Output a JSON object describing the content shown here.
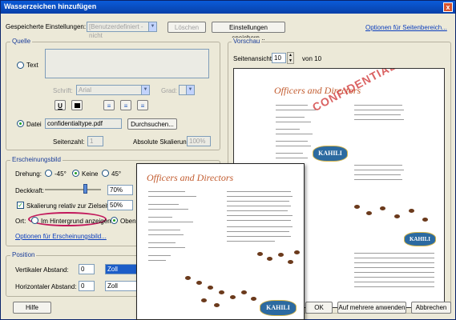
{
  "window": {
    "title": "Wasserzeichen hinzufügen",
    "close": "x"
  },
  "top": {
    "saved_label": "Gespeicherte Einstellungen:",
    "saved_value": "[Benutzerdefiniert - nicht",
    "delete": "Löschen",
    "save": "Einstellungen speichern...",
    "options_link": "Optionen für Seitenbereich..."
  },
  "quelle": {
    "group": "Quelle",
    "text_radio": "Text",
    "font_label": "Schrift:",
    "font_value": "Arial",
    "grad_label": "Grad:",
    "underline": "U",
    "file_radio": "Datei",
    "file_value": "confidentialtype.pdf",
    "browse": "Durchsuchen...",
    "page_label": "Seitenzahl:",
    "page_value": "1",
    "abs_scale_label": "Absolute Skalierung:",
    "abs_scale_value": "100%"
  },
  "erscheinung": {
    "group": "Erscheinungsbild",
    "rotation_label": "Drehung:",
    "rot_m45": "-45°",
    "rot_none": "Keine",
    "rot_45": "45°",
    "opacity_label": "Deckkraft:",
    "opacity_value": "70%",
    "scale_relative": "Skalierung relativ zur Zielseite",
    "scale_value": "50%",
    "location_label": "Ort:",
    "background": "Im Hintergrund anzeigen",
    "on_top": "Oben auf",
    "options_link": "Optionen für Erscheinungsbild..."
  },
  "position": {
    "group": "Position",
    "vertical_label": "Vertikaler Abstand:",
    "vertical_value": "0",
    "vertical_unit": "Zoll",
    "horizontal_label": "Horizontaler Abstand:",
    "horizontal_value": "0",
    "horizontal_unit": "Zoll"
  },
  "preview": {
    "group": "Vorschau",
    "page_view_label": "Seitenansicht",
    "page_value": "10",
    "of_pages": "von 10",
    "doc_title": "Officers and Directors",
    "watermark": "CONFIDENTIAL",
    "logo": "KAHILI"
  },
  "bottom": {
    "help": "Hilfe",
    "ok": "OK",
    "apply_multiple": "Auf mehrere anwenden",
    "cancel": "Abbrechen"
  },
  "colors": {
    "accent": "#0a5bd8",
    "doc_title": "#c25b2e",
    "watermark": "#d23c3c",
    "highlight_circle": "#c2185b"
  }
}
